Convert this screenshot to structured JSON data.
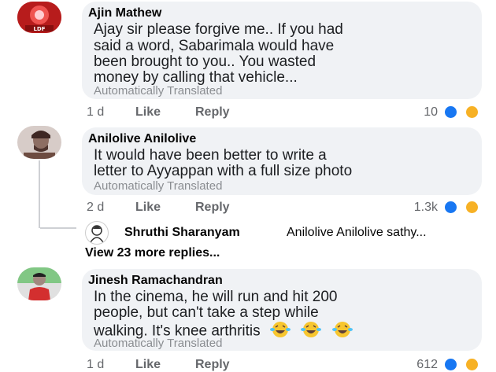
{
  "comments": [
    {
      "author": "Ajin Mathew",
      "lines": [
        "Ajay sir please forgive me.. If you had",
        "said a word, Sabarimala would have",
        "been brought to you.. You wasted",
        "money by calling that vehicle..."
      ],
      "translated": "Automatically Translated",
      "time": "1 d",
      "like": "Like",
      "reply": "Reply",
      "reaction_count": "10",
      "avatar_badge": "LDF"
    },
    {
      "author": "Anilolive Anilolive",
      "lines": [
        "It would have been better to write a",
        "letter to Ayyappan with a full size photo"
      ],
      "translated": "Automatically Translated",
      "time": "2 d",
      "like": "Like",
      "reply": "Reply",
      "reaction_count": "1.3k",
      "reply_preview": {
        "name": "Shruthi Sharanyam",
        "snippet": "Anilolive Anilolive sathy..."
      },
      "view_more": "View 23 more replies..."
    },
    {
      "author": "Jinesh Ramachandran",
      "lines": [
        "In the cinema, he will run and hit 200",
        "people, but can't take a step while",
        "walking. It's knee arthritis"
      ],
      "translated": "Automatically Translated",
      "time": "1 d",
      "like": "Like",
      "reply": "Reply",
      "reaction_count": "612"
    }
  ],
  "colors": {
    "bubble": "#f0f2f5",
    "like_blue": "#1877f2",
    "haha_yellow": "#f7b125",
    "secondary_text": "#65676b"
  },
  "icons": [
    "like-reaction-icon",
    "haha-reaction-icon",
    "laughing-emoji-icon"
  ]
}
